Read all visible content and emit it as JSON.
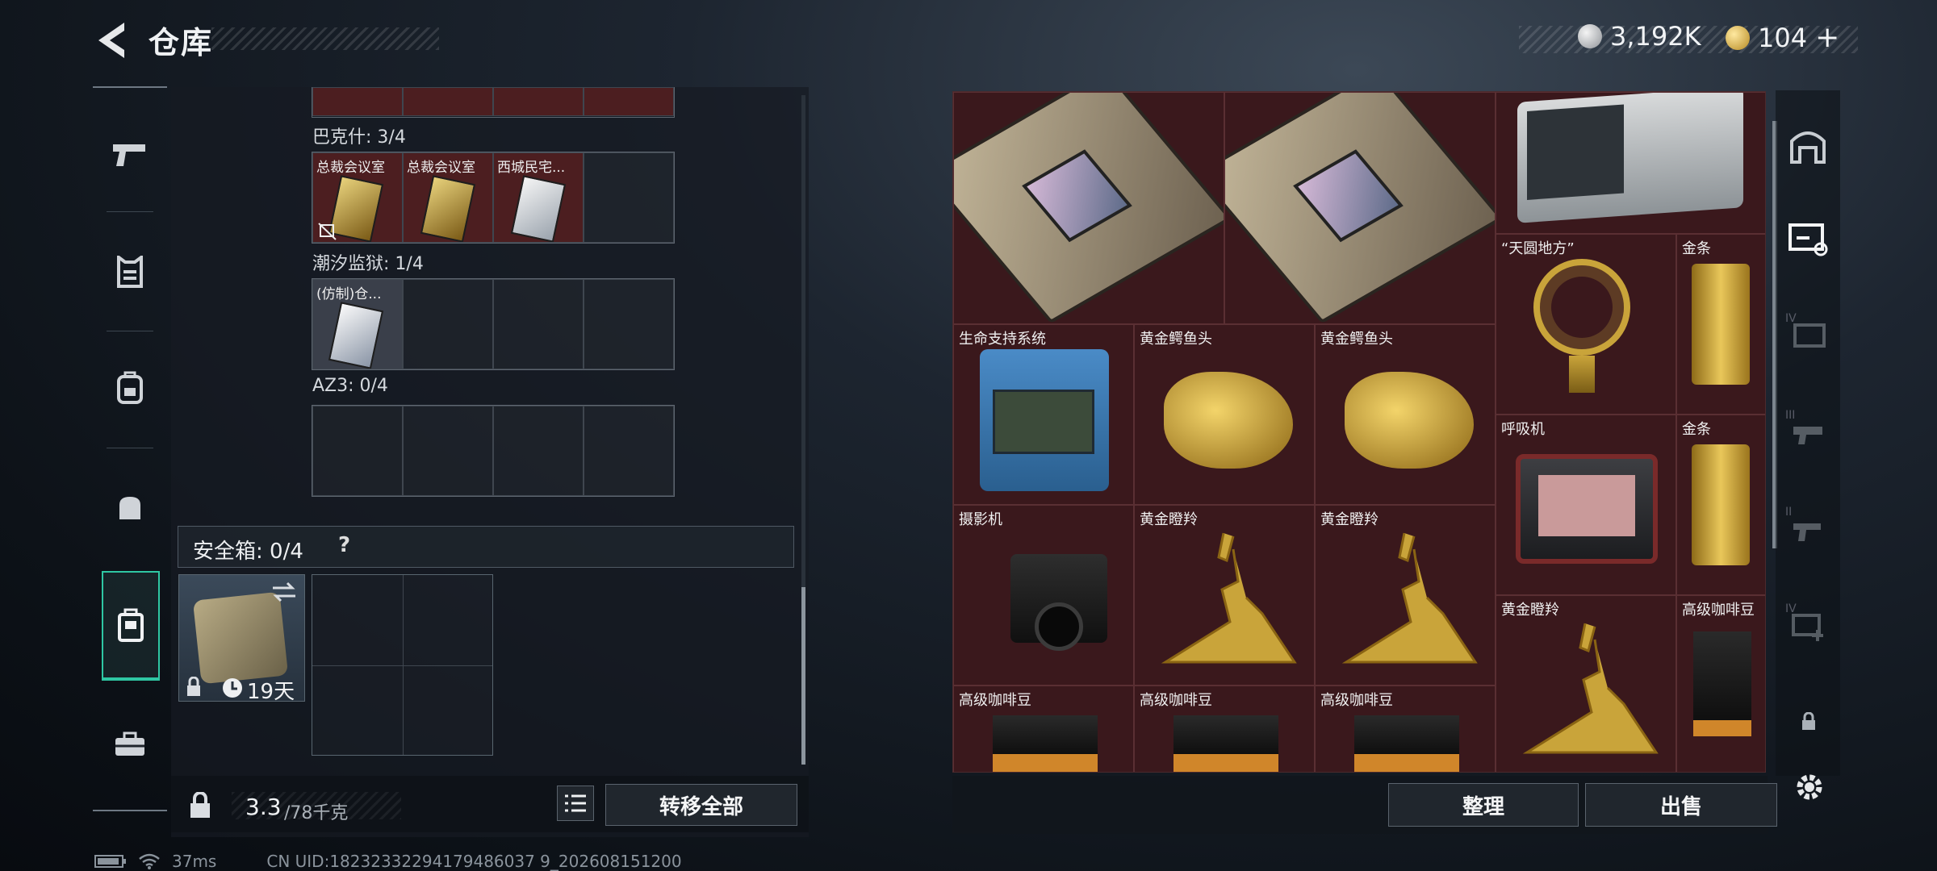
{
  "header": {
    "title": "仓库"
  },
  "currency": {
    "silver": "3,192K",
    "gold": "104",
    "plus": "+"
  },
  "left_panel": {
    "groups": [
      {
        "label": "巴克什: 3/4",
        "items": [
          "总裁会议室",
          "总裁会议室",
          "西城民宅..."
        ]
      },
      {
        "label": "潮汐监狱: 1/4",
        "items": [
          "(仿制)仓..."
        ]
      },
      {
        "label": "AZ3: 0/4",
        "items": []
      }
    ],
    "safe_box": {
      "label": "安全箱: 0/4",
      "help": "?",
      "duration": "19天"
    },
    "weight": {
      "value": "3.3",
      "max": "/78千克"
    },
    "transfer_all": "转移全部"
  },
  "stash": {
    "labels": {
      "c_tianyuan": "“天圆地方”",
      "c_gold1": "金条",
      "c_life": "生命支持系统",
      "c_croc1": "黄金鳄鱼头",
      "c_croc2": "黄金鳄鱼头",
      "c_breath": "呼吸机",
      "c_gold2": "金条",
      "c_camera": "摄影机",
      "c_deer1": "黄金瞪羚",
      "c_deer2": "黄金瞪羚",
      "c_deer3": "黄金瞪羚",
      "c_coffee4": "高级咖啡豆",
      "c_coffee1": "高级咖啡豆",
      "c_coffee2": "高级咖啡豆",
      "c_coffee3": "高级咖啡豆"
    },
    "sort_button": "整理",
    "sell_button": "出售"
  },
  "right_nav": {
    "tabs": [
      "",
      "",
      "IV",
      "III",
      "II",
      "IV"
    ]
  },
  "status_bar": {
    "ping": "37ms",
    "uid": "CN UID:18232332294179486037 9_202608151200"
  },
  "colors": {
    "accent": "#2fc7a3",
    "item_bg": "#3a181c",
    "gold": "#c9a43a"
  }
}
